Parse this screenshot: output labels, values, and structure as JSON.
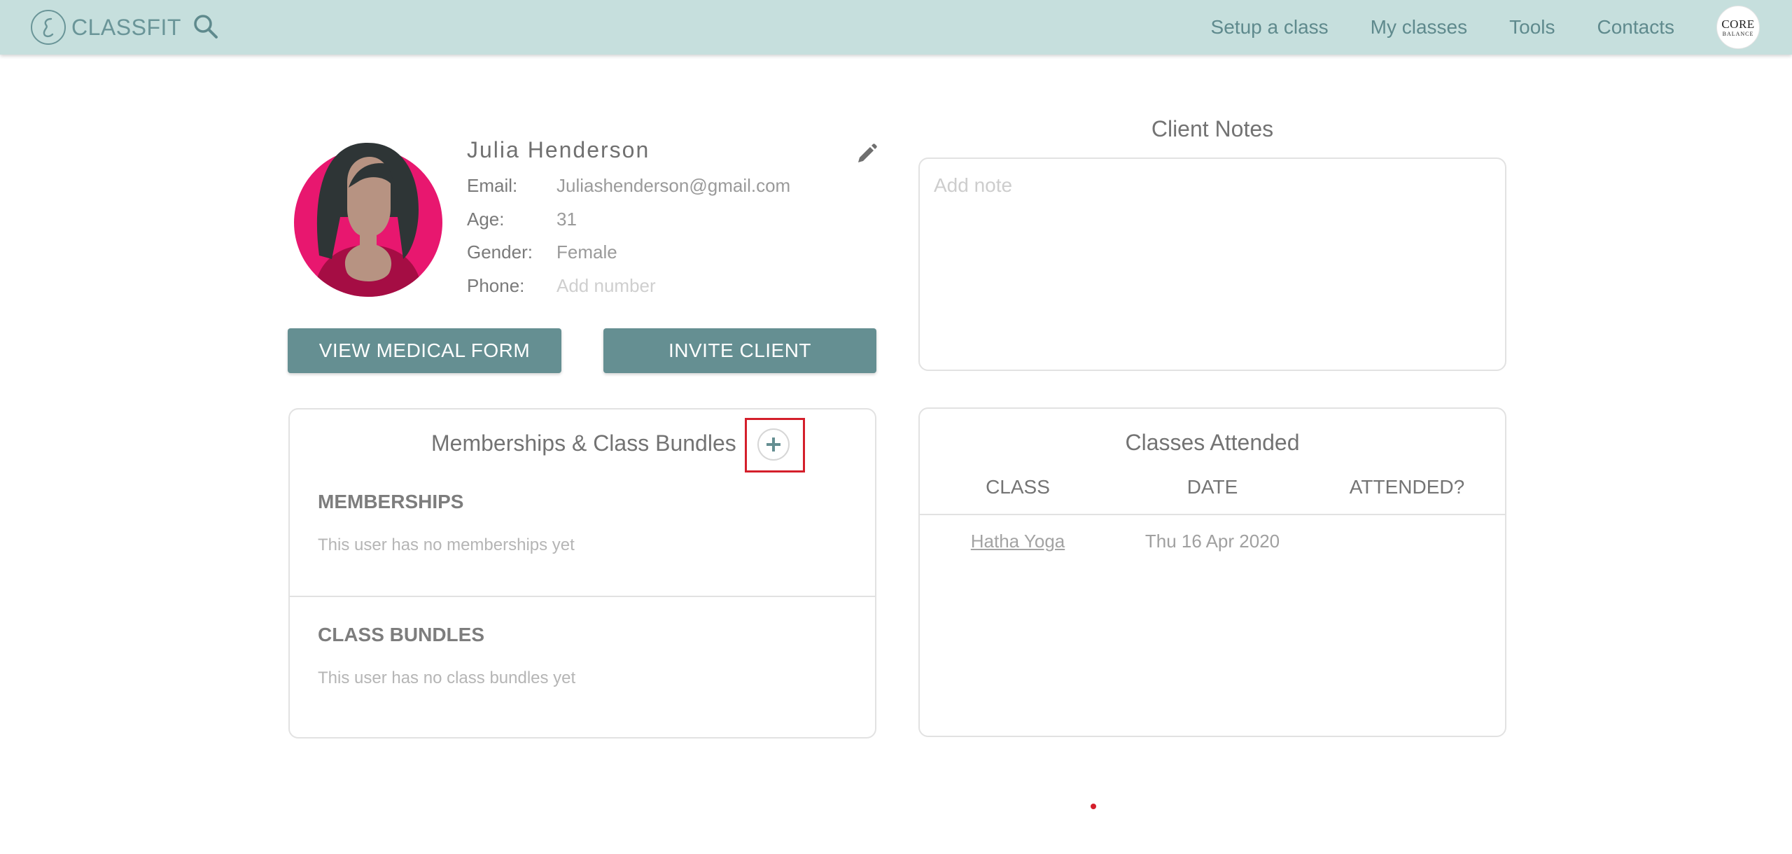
{
  "app": {
    "logo_text": "CLASSFIT",
    "brand_color": "#c6dfdd",
    "accent_color": "#658f92",
    "highlight_color": "#d41f2b"
  },
  "nav": {
    "items": [
      {
        "label": "Setup a class"
      },
      {
        "label": "My classes"
      },
      {
        "label": "Tools"
      },
      {
        "label": "Contacts"
      }
    ],
    "studio_logo": {
      "line1": "CORE",
      "line2": "BALANCE"
    }
  },
  "icons": {
    "search": "search-icon",
    "edit": "pencil-icon",
    "add": "plus-icon",
    "logo": "classfit-logo-icon"
  },
  "client": {
    "name": "Julia Henderson",
    "fields": [
      {
        "label": "Email:",
        "value": "Juliashenderson@gmail.com",
        "placeholder": false
      },
      {
        "label": "Age:",
        "value": "31",
        "placeholder": false
      },
      {
        "label": "Gender:",
        "value": "Female",
        "placeholder": false
      },
      {
        "label": "Phone:",
        "value": "Add number",
        "placeholder": true
      }
    ]
  },
  "buttons": {
    "medical": "VIEW MEDICAL FORM",
    "invite": "INVITE CLIENT"
  },
  "notes": {
    "title": "Client Notes",
    "placeholder": "Add note"
  },
  "memberships": {
    "title": "Memberships & Class Bundles",
    "memberships_heading": "MEMBERSHIPS",
    "memberships_empty": "This user has no memberships yet",
    "bundles_heading": "CLASS BUNDLES",
    "bundles_empty": "This user has no class bundles yet"
  },
  "classes_attended": {
    "title": "Classes Attended",
    "columns": [
      "CLASS",
      "DATE",
      "ATTENDED?"
    ],
    "rows": [
      {
        "class": "Hatha Yoga",
        "date": "Thu 16 Apr 2020",
        "attended": ""
      }
    ]
  }
}
